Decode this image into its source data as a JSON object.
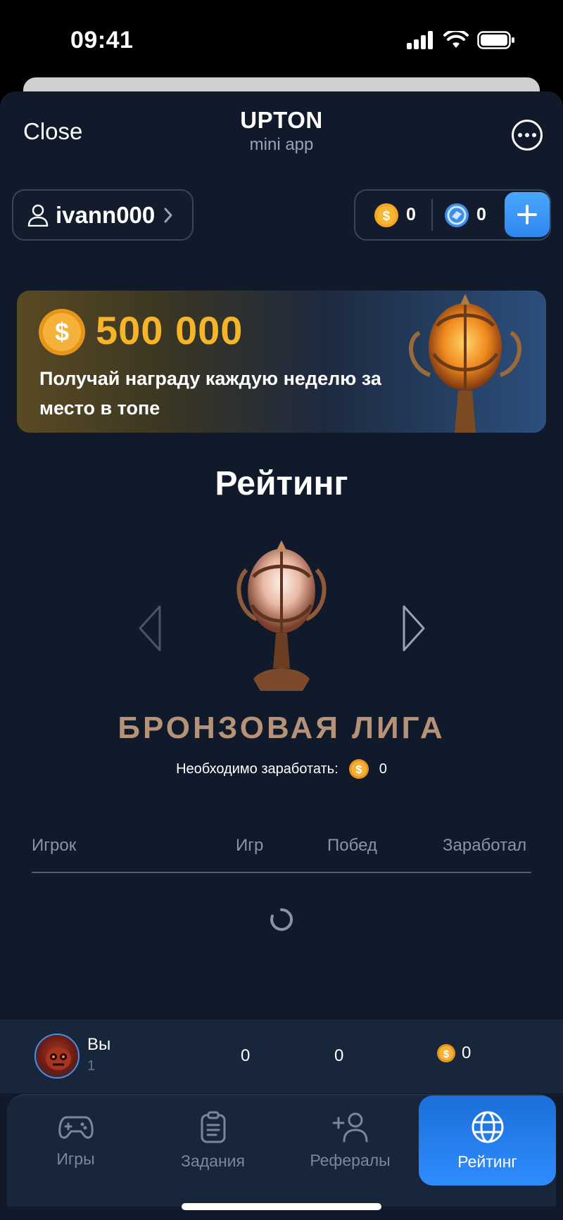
{
  "status_bar": {
    "time": "09:41"
  },
  "header": {
    "close_label": "Close",
    "title": "UPTON",
    "subtitle": "mini app"
  },
  "user": {
    "username": "ivann000"
  },
  "balances": {
    "coins": "0",
    "tokens": "0"
  },
  "banner": {
    "amount": "500 000",
    "text": "Получай награду каждую неделю за место в топе"
  },
  "rating": {
    "title": "Рейтинг",
    "league_name": "БРОНЗОВАЯ ЛИГА",
    "requirement_label": "Необходимо заработать:",
    "requirement_value": "0"
  },
  "table": {
    "columns": [
      "Игрок",
      "Игр",
      "Побед",
      "Заработал"
    ]
  },
  "me": {
    "name": "Вы",
    "rank": "1",
    "games": "0",
    "wins": "0",
    "earned": "0"
  },
  "tabs": [
    {
      "label": "Игры",
      "icon": "gamepad-icon"
    },
    {
      "label": "Задания",
      "icon": "clipboard-icon"
    },
    {
      "label": "Рефералы",
      "icon": "add-user-icon"
    },
    {
      "label": "Рейтинг",
      "icon": "globe-icon",
      "active": true
    }
  ],
  "colors": {
    "background": "#101a2b",
    "accent": "#2f8cff",
    "coin": "#f5b52a"
  }
}
